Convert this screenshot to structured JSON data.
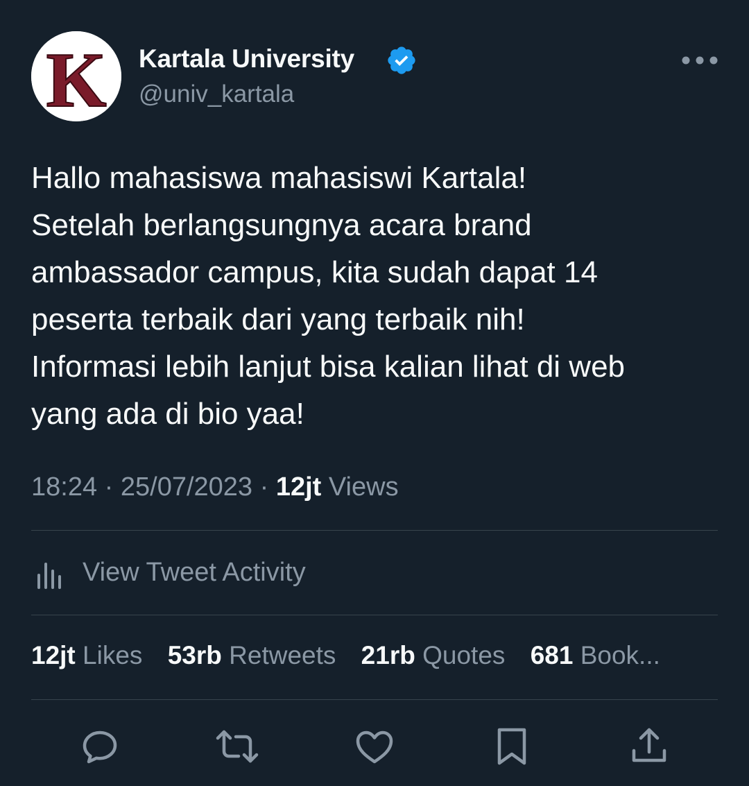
{
  "account": {
    "display_name": "Kartala University",
    "handle": "@univ_kartala",
    "avatar_letter": "K",
    "verified": true,
    "verified_color": "#1d9bf0",
    "avatar_color": "#7a1b2a"
  },
  "tweet": {
    "lines": [
      "Hallo mahasiswa mahasiswi Kartala!",
      "Setelah berlangsungnya acara brand",
      "ambassador campus, kita sudah dapat 14",
      "peserta terbaik dari yang terbaik nih!",
      "Informasi lebih lanjut bisa kalian lihat di web",
      "yang ada di bio yaa!"
    ],
    "time": "18:24",
    "date": "25/07/2023",
    "separator": "·",
    "views_count": "12jt",
    "views_label": "Views"
  },
  "activity": {
    "label": "View Tweet Activity",
    "icon": "bar-chart-icon"
  },
  "stats": [
    {
      "count": "12jt",
      "label": "Likes"
    },
    {
      "count": "53rb",
      "label": "Retweets"
    },
    {
      "count": "21rb",
      "label": "Quotes"
    },
    {
      "count": "681",
      "label": "Book..."
    }
  ],
  "actions": [
    {
      "name": "reply",
      "icon": "reply-icon"
    },
    {
      "name": "retweet",
      "icon": "retweet-icon"
    },
    {
      "name": "like",
      "icon": "heart-icon"
    },
    {
      "name": "bookmark",
      "icon": "bookmark-icon"
    },
    {
      "name": "share",
      "icon": "share-icon"
    }
  ],
  "colors": {
    "background": "#15202b",
    "text": "#f7f9f9",
    "muted": "#8b98a5",
    "divider": "#38444d"
  }
}
